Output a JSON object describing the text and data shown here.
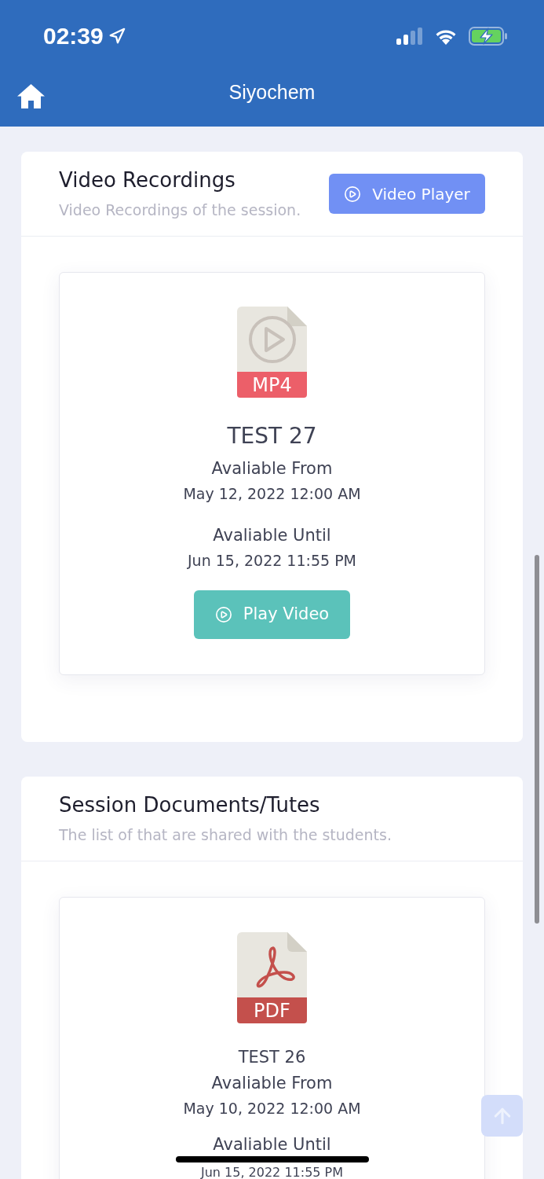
{
  "status_bar": {
    "time": "02:39"
  },
  "header": {
    "title": "Siyochem"
  },
  "sections": [
    {
      "title": "Video Recordings",
      "subtitle": "Video Recordings of the session.",
      "action": {
        "label": "Video Player"
      },
      "items": [
        {
          "kind": "mp4",
          "file_label": "MP4",
          "title": "TEST 27",
          "from_label": "Avaliable From",
          "from": "May 12, 2022 12:00 AM",
          "until_label": "Avaliable Until",
          "until": "Jun 15, 2022 11:55 PM",
          "button": "Play Video"
        }
      ]
    },
    {
      "title": "Session Documents/Tutes",
      "subtitle": "The list of that are shared with the students.",
      "items": [
        {
          "kind": "pdf",
          "file_label": "PDF",
          "title": "TEST 26",
          "from_label": "Avaliable From",
          "from": "May 10, 2022 12:00 AM",
          "until_label": "Avaliable Until",
          "until": "Jun 15, 2022 11:55 PM"
        }
      ]
    }
  ]
}
